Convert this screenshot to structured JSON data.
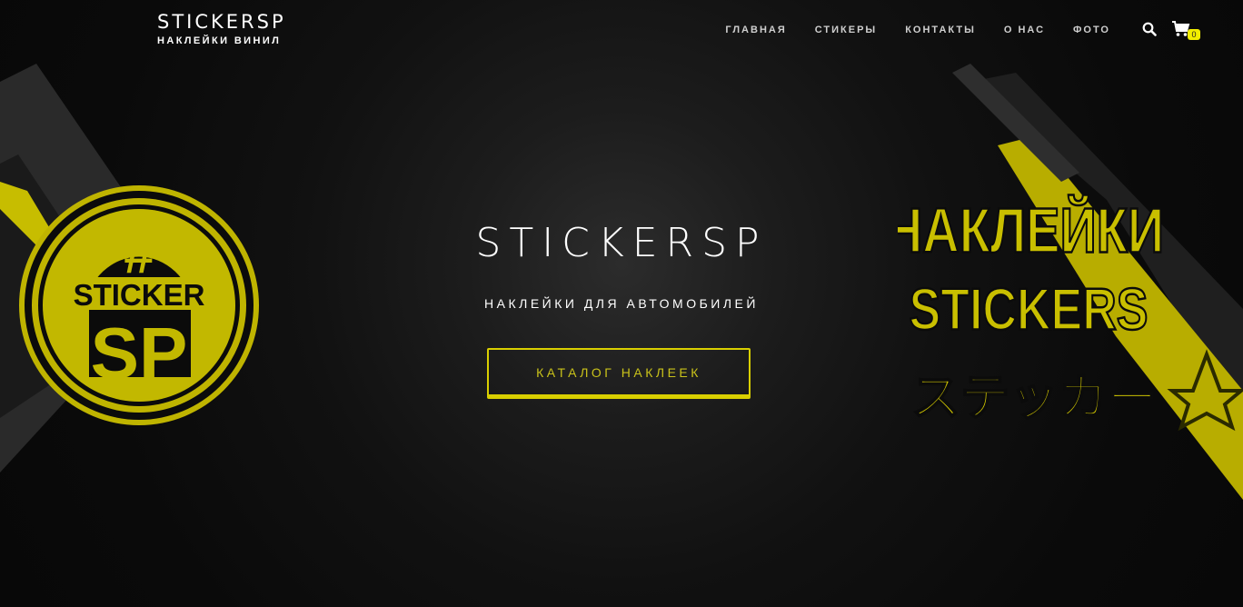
{
  "header": {
    "brand_title": "STICKERSP",
    "brand_subtitle": "НАКЛЕЙКИ ВИНИЛ",
    "nav": [
      {
        "label": "ГЛАВНАЯ"
      },
      {
        "label": "СТИКЕРЫ"
      },
      {
        "label": "КОНТАКТЫ"
      },
      {
        "label": "О НАС"
      },
      {
        "label": "ФОТО"
      }
    ],
    "search_icon": "search-icon",
    "cart_icon": "cart-icon",
    "cart_count": "0"
  },
  "hero": {
    "title": "STICKERSP",
    "subtitle": "НАКЛЕЙКИ ДЛЯ АВТОМОБИЛЕЙ",
    "button_label": "КАТАЛОГ НАКЛЕЕК"
  },
  "art": {
    "logo_hash": "#",
    "logo_word": "STICKER",
    "logo_letters": "SP",
    "right_line1": "НАКЛЕЙКИ",
    "right_line2": "STICKERS",
    "right_line3": "ステッカー"
  },
  "colors": {
    "accent": "#d9cf00",
    "background": "#0b0b0b",
    "text": "#ffffff"
  }
}
